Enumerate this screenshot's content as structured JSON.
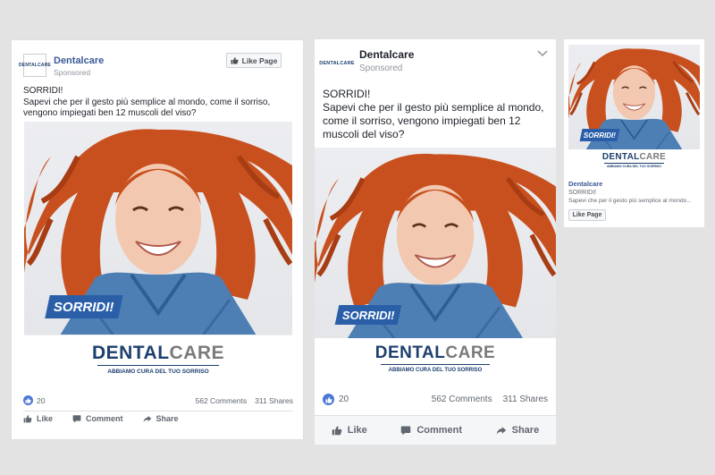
{
  "brand": {
    "page_name": "Dentalcare",
    "sponsored": "Sponsored",
    "logo_small": "DENTALCARE",
    "logo_dental": "DENTAL",
    "logo_care": "CARE",
    "logo_tagline": "ABBIAMO CURA DEL TUO SORRISO"
  },
  "post": {
    "lines_card1": [
      "SORRIDI!",
      "Sapevi che per il gesto più semplice al mondo, come il sorriso,",
      "vengono impiegati ben 12 muscoli del viso?"
    ],
    "lines_card2": [
      "SORRIDI!",
      "Sapevi che per il gesto più semplice al mondo,",
      "come il sorriso, vengono impiegati ben 12",
      "muscoli del viso?"
    ],
    "headline_tag": "SORRIDI!"
  },
  "stats": {
    "likes": "20",
    "comments": "562 Comments",
    "shares": "311 Shares"
  },
  "actions": {
    "like": "Like",
    "comment": "Comment",
    "share": "Share",
    "like_page": "Like Page"
  },
  "sidebar_ad": {
    "title": "Dentalcare",
    "line1": "SORRIDI!",
    "line2": "Sapevi che per il gesto più semplice al mondo..."
  },
  "colors": {
    "fb_blue": "#3b5998",
    "brand_navy": "#1c3f6e",
    "tag_blue": "#2a5fa8",
    "hair": "#c8501f"
  },
  "icons": [
    "thumbs-up-icon",
    "comment-icon",
    "share-icon",
    "chevron-down-icon"
  ]
}
